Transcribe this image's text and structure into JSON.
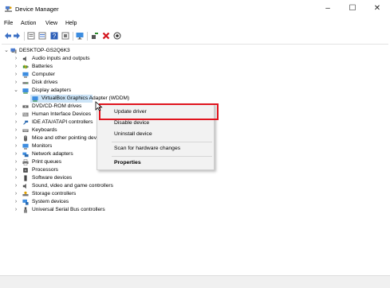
{
  "window": {
    "title": "Device Manager",
    "controls": {
      "minimize": "–",
      "maximize": "☐",
      "close": "✕"
    }
  },
  "menu": [
    "File",
    "Action",
    "View",
    "Help"
  ],
  "toolbar": {
    "icons": [
      "back-arrow-icon",
      "forward-arrow-icon",
      "properties-icon",
      "list-view-icon",
      "help-icon",
      "device-view-icon",
      "monitor-icon",
      "add-driver-icon",
      "remove-device-icon",
      "download-icon"
    ],
    "colors": {
      "remove": "#d4141c",
      "add": "#2f8f2f"
    }
  },
  "tree": {
    "root": "DESKTOP-GS2Q6K3",
    "items": [
      {
        "label": "Audio inputs and outputs",
        "icon": "speaker-icon"
      },
      {
        "label": "Batteries",
        "icon": "battery-icon"
      },
      {
        "label": "Computer",
        "icon": "computer-icon"
      },
      {
        "label": "Disk drives",
        "icon": "disk-drive-icon"
      },
      {
        "label": "Display adapters",
        "icon": "display-adapter-icon"
      },
      {
        "label": "VirtualBox Graphics Adapter (WDDM)",
        "icon": "display-adapter-icon"
      },
      {
        "label": "DVD/CD-ROM drives",
        "icon": "dvd-drive-icon"
      },
      {
        "label": "Human Interface Devices",
        "icon": "hid-icon"
      },
      {
        "label": "IDE ATA/ATAPI controllers",
        "icon": "ide-controller-icon"
      },
      {
        "label": "Keyboards",
        "icon": "keyboard-icon"
      },
      {
        "label": "Mice and other pointing devices",
        "icon": "mouse-icon"
      },
      {
        "label": "Monitors",
        "icon": "monitor-icon"
      },
      {
        "label": "Network adapters",
        "icon": "network-adapter-icon"
      },
      {
        "label": "Print queues",
        "icon": "printer-icon"
      },
      {
        "label": "Processors",
        "icon": "processor-icon"
      },
      {
        "label": "Software devices",
        "icon": "software-device-icon"
      },
      {
        "label": "Sound, video and game controllers",
        "icon": "speaker-icon"
      },
      {
        "label": "Storage controllers",
        "icon": "storage-controller-icon"
      },
      {
        "label": "System devices",
        "icon": "system-devices-icon"
      },
      {
        "label": "Universal Serial Bus controllers",
        "icon": "usb-icon"
      }
    ],
    "selected_color": "#cce4f7"
  },
  "context_menu": {
    "items": [
      "Update driver",
      "Disable device",
      "Uninstall device",
      "Scan for hardware changes",
      "Properties"
    ],
    "highlight_color": "#e0141e"
  }
}
